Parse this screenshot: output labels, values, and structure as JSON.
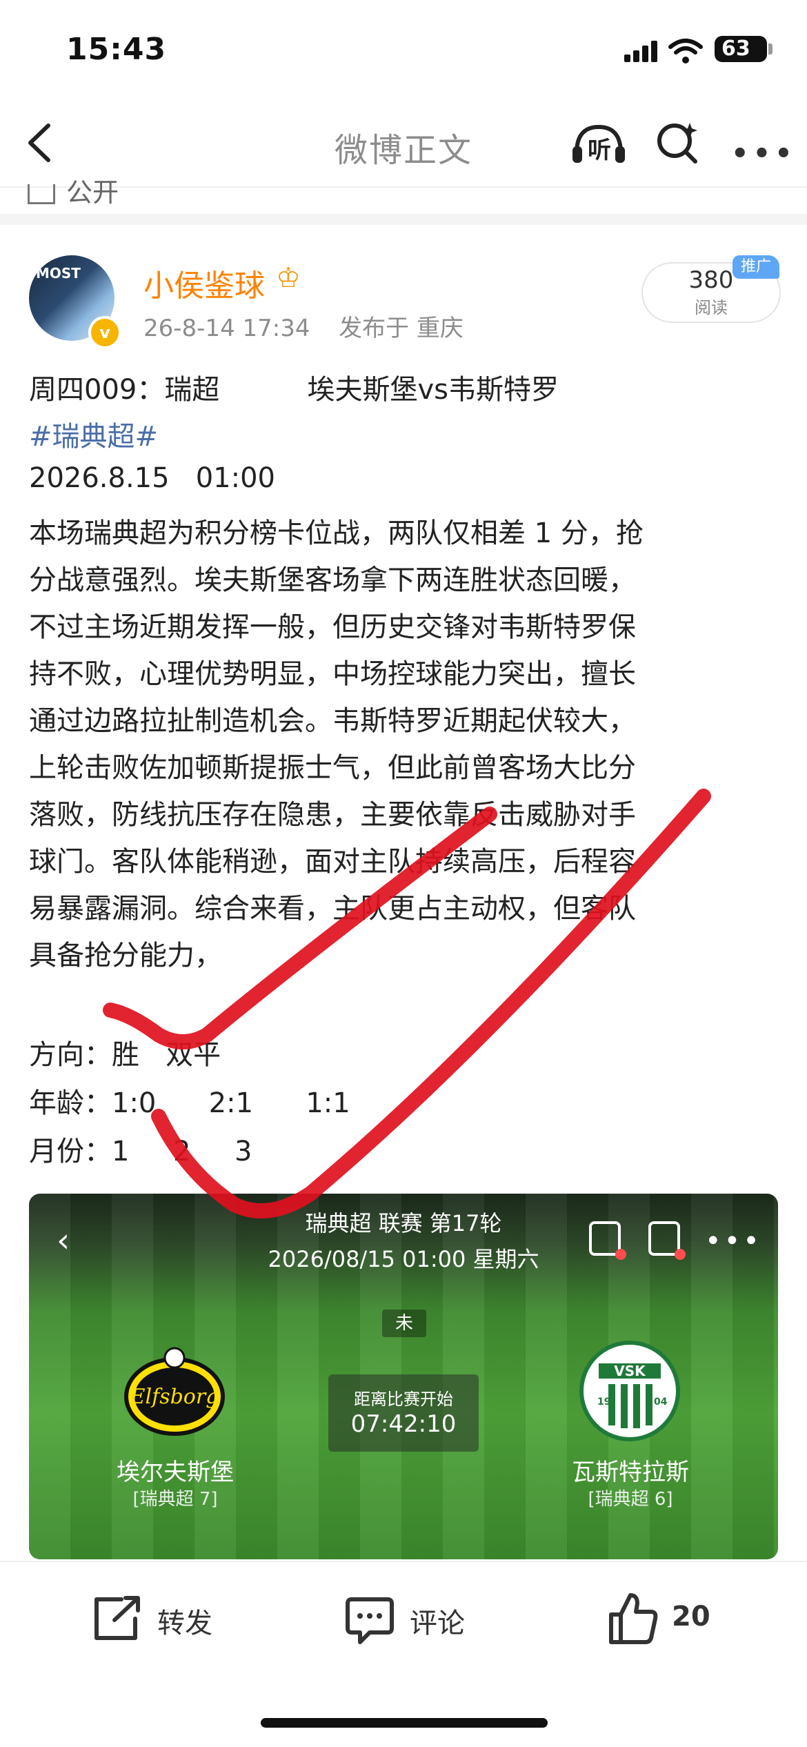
{
  "status_bar": {
    "time": "15:43",
    "battery": "63"
  },
  "nav": {
    "title": "微博正文",
    "listen_label": "听"
  },
  "previous_post_cut": "公开",
  "author": {
    "name": "小侯鉴球",
    "avatar_text": "MOST",
    "post_time": "26-8-14 17:34",
    "post_location": "发布于 重庆",
    "views_count": "380",
    "views_label": "阅读",
    "promo_tag": "推广"
  },
  "post": {
    "line1": "周四009：瑞超          埃夫斯堡vs韦斯特罗",
    "topic": "#瑞典超#",
    "datetime": "2026.8.15   01:00",
    "paragraph": [
      "本场瑞典超为积分榜卡位战，两队仅相差 1 分，抢",
      "分战意强烈。埃夫斯堡客场拿下两连胜状态回暖，",
      "不过主场近期发挥一般，但历史交锋对韦斯特罗保",
      "持不败，心理优势明显，中场控球能力突出，擅长",
      "通过边路拉扯制造机会。韦斯特罗近期起伏较大，",
      "上轮击败佐加顿斯提振士气，但此前曾客场大比分",
      "落败，防线抗压存在隐患，主要依靠反击威胁对手",
      "球门。客队体能稍逊，面对主队持续高压，后程容",
      "易暴露漏洞。综合来看，主队更占主动权，但客队",
      "具备抢分能力，"
    ],
    "direction_line": "方向：胜   双平",
    "age_line": "年龄：1:0      2:1      1:1",
    "month_line": "月份：1     2     3"
  },
  "match_card": {
    "title": "瑞典超 联赛 第17轮",
    "datetime": "2026/08/15 01:00  星期六",
    "status": "未",
    "countdown_label": "距离比赛开始",
    "countdown_value": "07:42:10",
    "home_team": {
      "name": "埃尔夫斯堡",
      "rank": "[瑞典超 7]",
      "logo_text": "Elfsborg"
    },
    "away_team": {
      "name": "瓦斯特拉斯",
      "rank": "[瑞典超 6]",
      "logo_text": "VSK",
      "logo_year_left": "19",
      "logo_year_right": "04"
    }
  },
  "actions": {
    "repost_label": "转发",
    "comment_label": "评论",
    "like_count": "20"
  },
  "colors": {
    "author_name": "#ff8200",
    "topic_link": "#4a6ea8",
    "promo_badge": "#5fa6f5",
    "checkmark": "#e0101e"
  }
}
